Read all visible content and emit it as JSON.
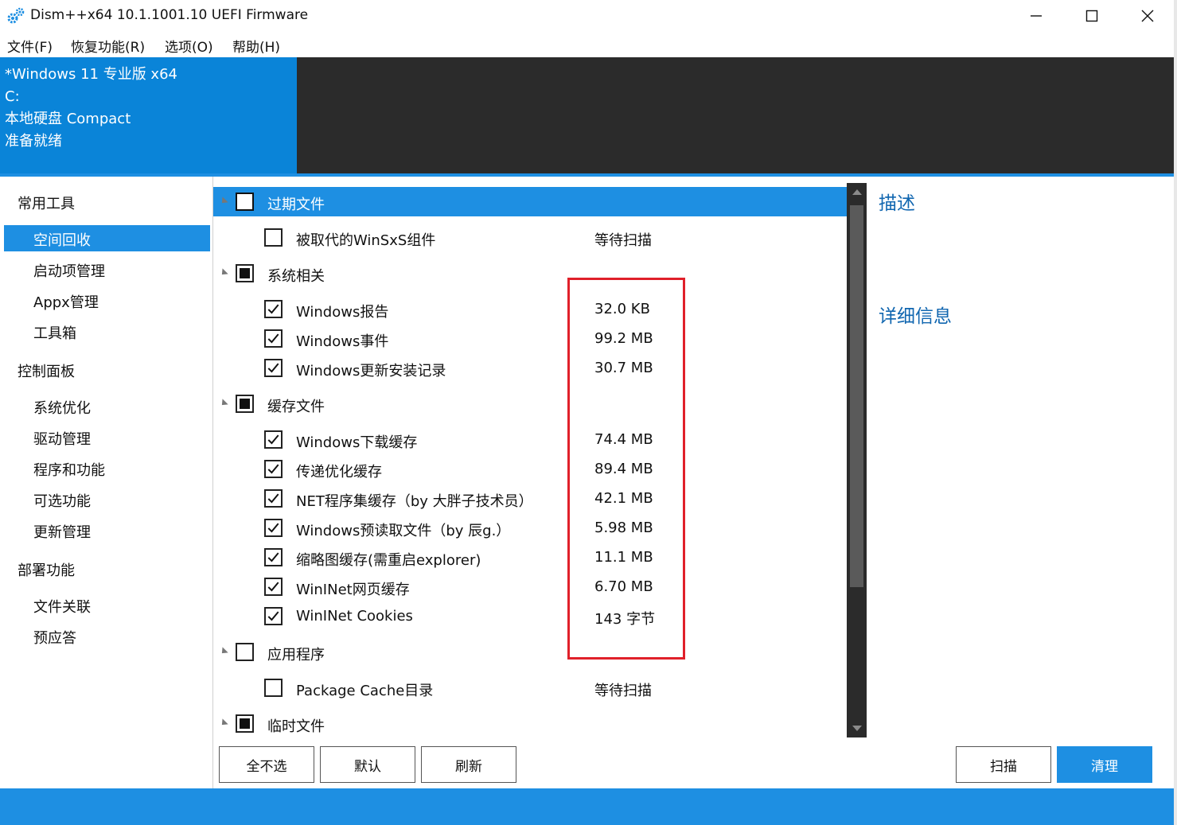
{
  "window": {
    "title": "Dism++x64 10.1.1001.10 UEFI Firmware",
    "controls": {
      "minimize": "minimize",
      "maximize": "maximize",
      "close": "close"
    }
  },
  "menu": [
    "文件(F)",
    "恢复功能(R)",
    "选项(O)",
    "帮助(H)"
  ],
  "header": {
    "lines": [
      "*Windows 11 专业版 x64",
      "C:",
      "本地硬盘 Compact",
      "准备就绪"
    ],
    "blue": "#0a84d8",
    "dark": "#2b2b2b"
  },
  "nav": {
    "groups": [
      {
        "label": "常用工具",
        "items": [
          "空间回收",
          "启动项管理",
          "Appx管理",
          "工具箱"
        ]
      },
      {
        "label": "控制面板",
        "items": [
          "系统优化",
          "驱动管理",
          "程序和功能",
          "可选功能",
          "更新管理"
        ]
      },
      {
        "label": "部署功能",
        "items": [
          "文件关联",
          "预应答"
        ]
      }
    ],
    "active": "空间回收"
  },
  "list": {
    "rows": [
      {
        "type": "category",
        "label": "过期文件",
        "checked": false,
        "selected": true
      },
      {
        "type": "item",
        "label": "被取代的WinSxS组件",
        "checked": false,
        "size": "等待扫描"
      },
      {
        "type": "category",
        "label": "系统相关",
        "checked": true,
        "selected": false
      },
      {
        "type": "item",
        "label": "Windows报告",
        "checked": true,
        "size": "32.0 KB"
      },
      {
        "type": "item",
        "label": "Windows事件",
        "checked": true,
        "size": "99.2 MB"
      },
      {
        "type": "item",
        "label": "Windows更新安装记录",
        "checked": true,
        "size": "30.7 MB"
      },
      {
        "type": "category",
        "label": "缓存文件",
        "checked": true,
        "selected": false
      },
      {
        "type": "item",
        "label": "Windows下载缓存",
        "checked": true,
        "size": "74.4 MB"
      },
      {
        "type": "item",
        "label": "传递优化缓存",
        "checked": true,
        "size": "89.4 MB"
      },
      {
        "type": "item",
        "label": "NET程序集缓存（by 大胖子技术员）",
        "checked": true,
        "size": "42.1 MB"
      },
      {
        "type": "item",
        "label": "Windows预读取文件（by 辰g.）",
        "checked": true,
        "size": "5.98 MB"
      },
      {
        "type": "item",
        "label": "缩略图缓存(需重启explorer)",
        "checked": true,
        "size": "11.1 MB"
      },
      {
        "type": "item",
        "label": "WinINet网页缓存",
        "checked": true,
        "size": "6.70 MB"
      },
      {
        "type": "item",
        "label": "WinINet Cookies",
        "checked": true,
        "size": "143 字节"
      },
      {
        "type": "category",
        "label": "应用程序",
        "checked": false,
        "selected": false
      },
      {
        "type": "item",
        "label": "Package Cache目录",
        "checked": false,
        "size": "等待扫描"
      },
      {
        "type": "category",
        "label": "临时文件",
        "checked": true,
        "selected": false
      }
    ],
    "highlight_color": "#e0202a"
  },
  "right_panel": {
    "description_title": "描述",
    "details_title": "详细信息"
  },
  "buttons": {
    "select_none": "全不选",
    "default": "默认",
    "refresh": "刷新",
    "scan": "扫描",
    "clean": "清理"
  },
  "accent": "#1e8fe2"
}
